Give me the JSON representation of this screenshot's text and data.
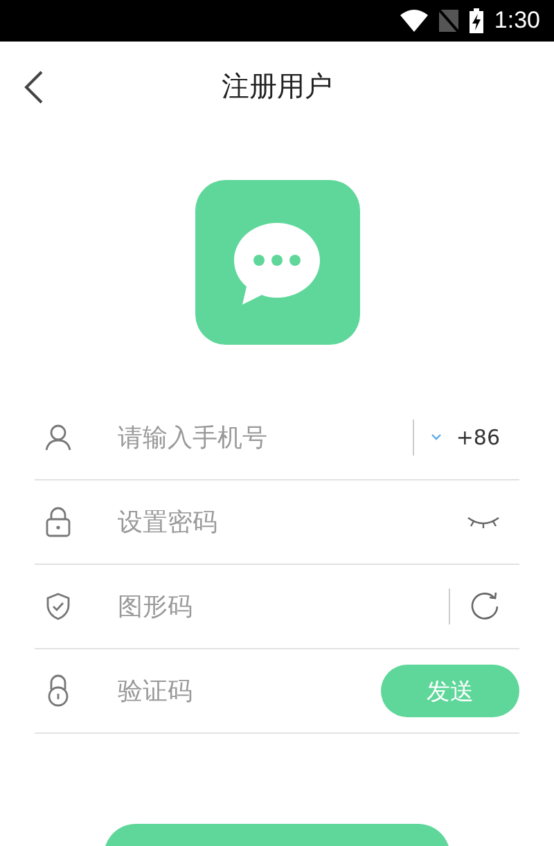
{
  "status_bar": {
    "time": "1:30"
  },
  "header": {
    "title": "注册用户"
  },
  "fields": [
    {
      "kind": "phone",
      "placeholder": "请输入手机号",
      "country_code": "+86"
    },
    {
      "kind": "password",
      "placeholder": "设置密码"
    },
    {
      "kind": "captcha",
      "placeholder": "图形码"
    },
    {
      "kind": "code",
      "placeholder": "验证码",
      "action": "发送"
    }
  ],
  "submit_button": {
    "kind": "button"
  }
}
